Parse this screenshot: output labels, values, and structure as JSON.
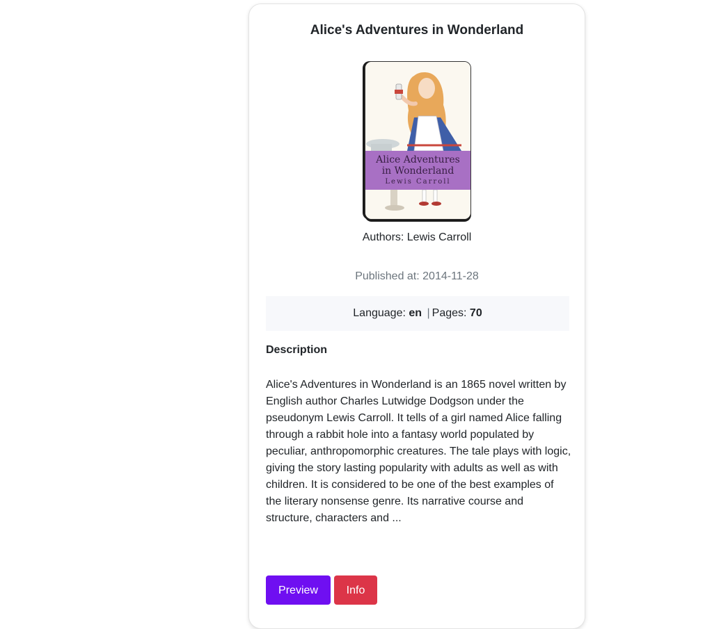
{
  "book": {
    "title": "Alice's Adventures in Wonderland",
    "cover": {
      "title_line1": "Alice Adventures",
      "title_line2": "in Wonderland",
      "author": "Lewis Carroll"
    },
    "authors_text": "Authors: Lewis Carroll",
    "published_text": "Published at: 2014-11-28",
    "language_label": "Language:",
    "language_value": "en",
    "separator": "|",
    "pages_label": "Pages:",
    "pages_value": "70",
    "description_heading": "Description",
    "description": "Alice's Adventures in Wonderland is an 1865 novel written by English author Charles Lutwidge Dodgson under the pseudonym Lewis Carroll. It tells of a girl named Alice falling through a rabbit hole into a fantasy world populated by peculiar, anthropomorphic creatures. The tale plays with logic, giving the story lasting popularity with adults as well as with children. It is considered to be one of the best examples of the literary nonsense genre. Its narrative course and structure, characters and ..."
  },
  "actions": {
    "preview_label": "Preview",
    "info_label": "Info"
  },
  "colors": {
    "preview_button": "#6f0ff1",
    "info_button": "#dc3548",
    "cover_band": "#a870c4"
  }
}
